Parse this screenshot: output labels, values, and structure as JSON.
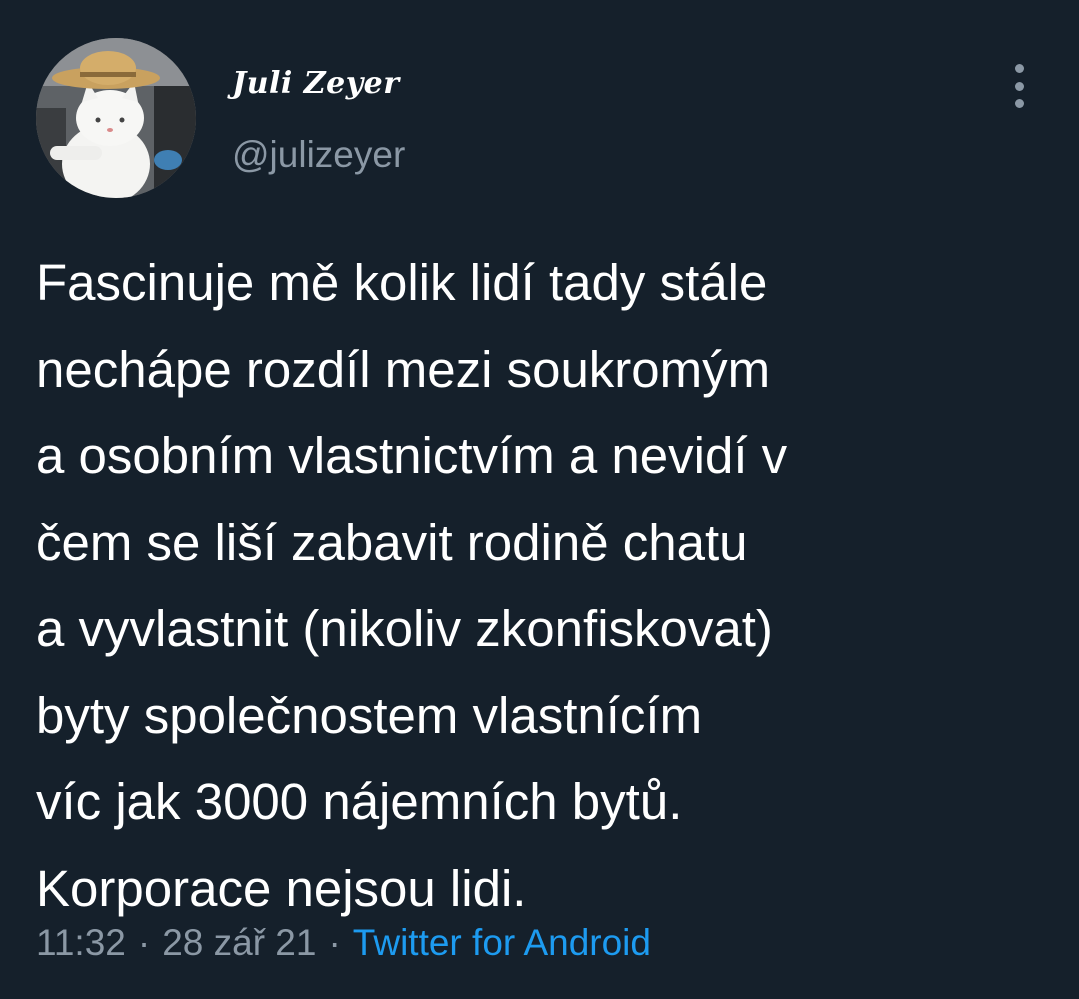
{
  "tweet": {
    "author": {
      "display_name": "Juli Zeyer",
      "handle": "@julizeyer",
      "avatar_icon": "cat-in-straw-hat-avatar"
    },
    "more_icon": "more-vertical-icon",
    "text_lines": [
      "Fascinuje mě kolik lidí tady stále",
      "nechápe rozdíl mezi soukromým",
      "a osobním vlastnictvím a nevidí v",
      "čem se liší zabavit rodině chatu",
      "a vyvlastnit (nikoliv zkonfiskovat)",
      "byty společnostem vlastnícím",
      "víc jak 3000 nájemních bytů.",
      "Korporace nejsou lidi."
    ],
    "meta": {
      "time": "11:32",
      "separator": "·",
      "date": "28 zář 21",
      "source": "Twitter for Android"
    }
  },
  "colors": {
    "background": "#15202b",
    "primary_text": "#ffffff",
    "secondary_text": "#8b98a5",
    "link": "#1d9bf0"
  }
}
